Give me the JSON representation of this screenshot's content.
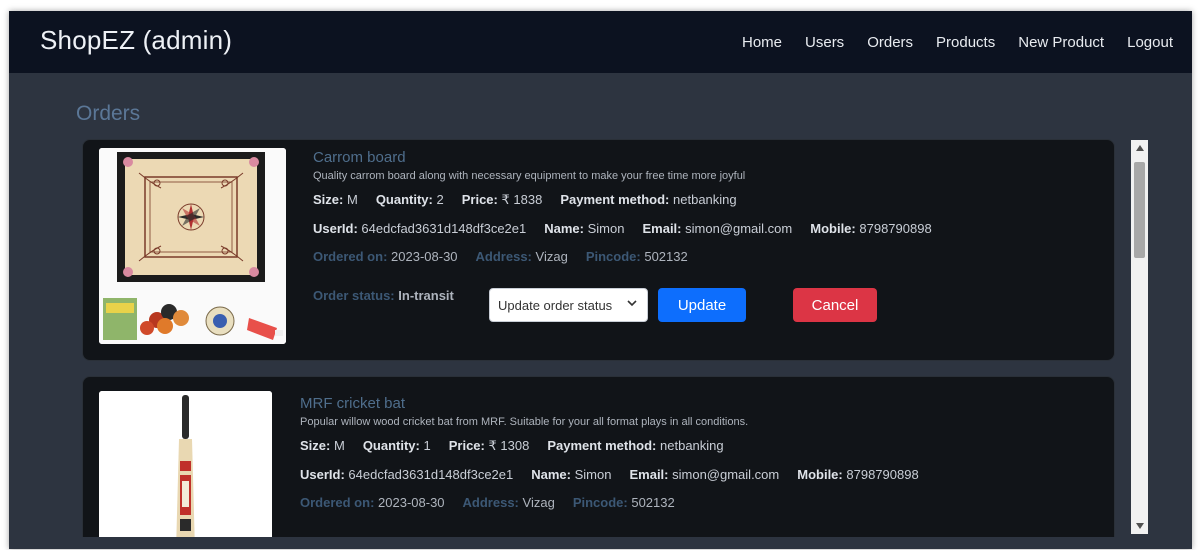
{
  "app": {
    "brand": "ShopEZ (admin)"
  },
  "nav": {
    "items": [
      "Home",
      "Users",
      "Orders",
      "Products",
      "New Product",
      "Logout"
    ]
  },
  "page": {
    "title": "Orders"
  },
  "labels": {
    "size": "Size:",
    "quantity": "Quantity:",
    "price": "Price:",
    "payment": "Payment method:",
    "userid": "UserId:",
    "name": "Name:",
    "email": "Email:",
    "mobile": "Mobile:",
    "ordered_on": "Ordered on:",
    "address": "Address:",
    "pincode": "Pincode:",
    "order_status": "Order status:"
  },
  "orders": [
    {
      "title": "Carrom board",
      "description": "Quality carrom board along with necessary equipment to make your free time more joyful",
      "size": "M",
      "quantity": "2",
      "price": "₹ 1838",
      "payment": "netbanking",
      "userid": "64edcfad3631d148df3ce2e1",
      "name": "Simon",
      "email": "simon@gmail.com",
      "mobile": "8798790898",
      "ordered_on": "2023-08-30",
      "address": "Vizag",
      "pincode": "502132",
      "status": "In-transit",
      "status_select": "Update order status",
      "update_label": "Update",
      "cancel_label": "Cancel",
      "image_icon": "carrom-board-icon"
    },
    {
      "title": "MRF cricket bat",
      "description": "Popular willow wood cricket bat from MRF. Suitable for your all format plays in all conditions.",
      "size": "M",
      "quantity": "1",
      "price": "₹ 1308",
      "payment": "netbanking",
      "userid": "64edcfad3631d148df3ce2e1",
      "name": "Simon",
      "email": "simon@gmail.com",
      "mobile": "8798790898",
      "ordered_on": "2023-08-30",
      "address": "Vizag",
      "pincode": "502132",
      "image_icon": "cricket-bat-icon"
    }
  ],
  "colors": {
    "navbar": "#0c1220",
    "page_bg": "#2d3440",
    "card_bg": "#111418",
    "title_blue": "#4f6e8c",
    "update_button": "#0d6efd",
    "cancel_button": "#dc3545"
  }
}
